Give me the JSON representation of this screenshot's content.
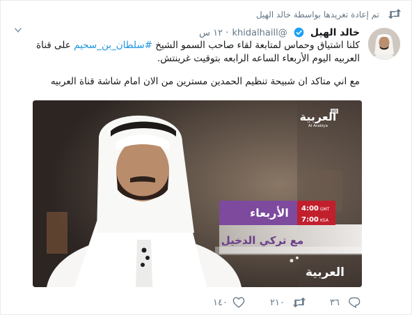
{
  "retweet": {
    "text": "تم إعادة تغريدها بواسطة خالد الهيل"
  },
  "tweet": {
    "display_name": "خالد الهيل",
    "handle": "@khidalhaill",
    "time": "١٢ س",
    "line1_before": "كلنا اشتياق وحماس لمتابعة لقاء صاحب السمو الشيخ ",
    "hashtag": "#سلطان_بن_سحيم",
    "line1_after": " على قناة",
    "line2": "العربيه اليوم الأربعاء الساعه الرابعه بتوقيت غرينتش.",
    "line3": "مع اني متاكد ان شبيحة تنظيم الحمدين مسترين من الان امام شاشة قناة العربيه"
  },
  "media": {
    "channel_logo": "العربية",
    "channel_sub": "Al Arabiya",
    "hd": "HD",
    "day": "الأربعاء",
    "time_gmt": "4:00",
    "gmt": "GMT",
    "time_ksa": "7:00",
    "ksa": "KSA",
    "program": "مع تركي الدخيل"
  },
  "actions": {
    "reply_count": "٣٦",
    "retweet_count": "٢١٠",
    "like_count": "١٤٠"
  },
  "colors": {
    "accent": "#1b95e0",
    "muted": "#657786",
    "purple": "#7d4a9e"
  },
  "icons": [
    "retweet-icon",
    "verified-icon",
    "chevron-down-icon",
    "reply-icon",
    "like-icon"
  ]
}
